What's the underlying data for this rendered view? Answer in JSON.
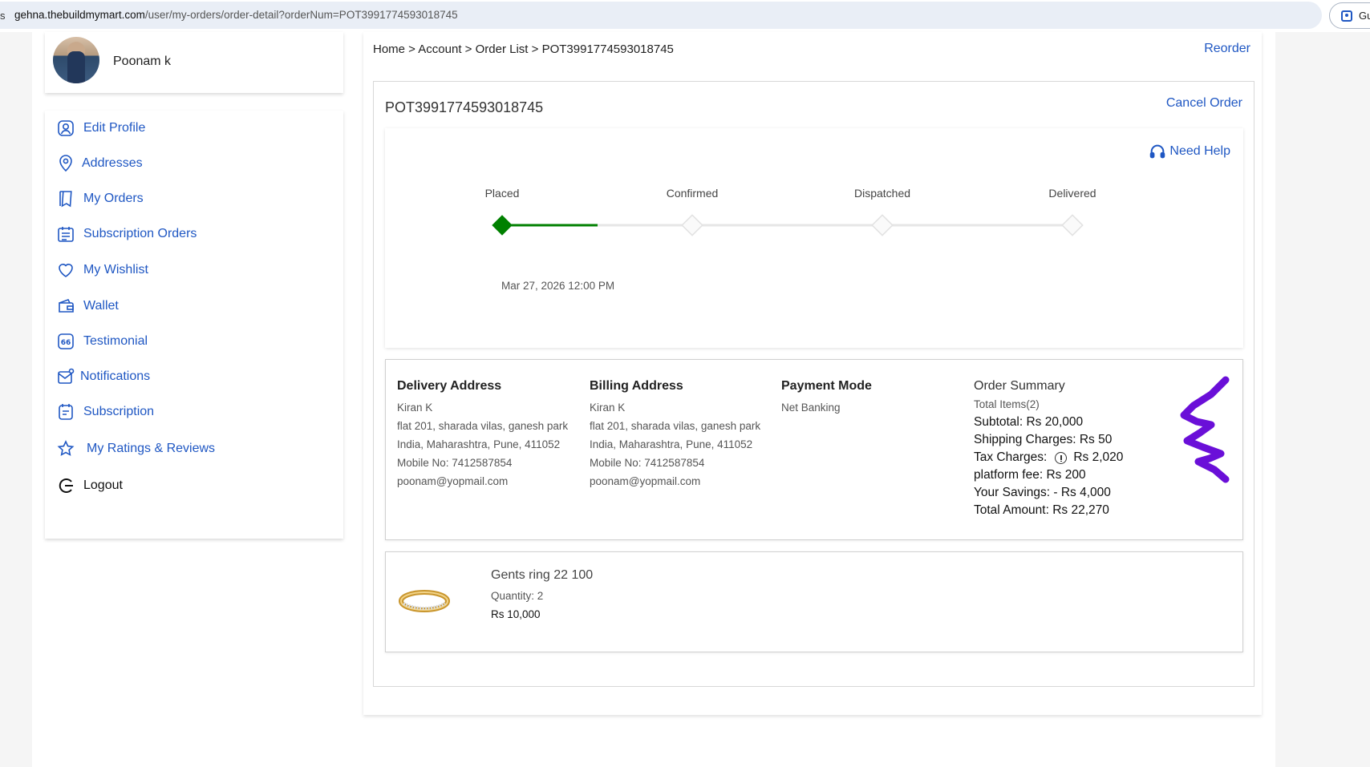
{
  "browser": {
    "url_prefix": "gehna.thebuildmymart.com",
    "url_path": "/user/my-orders/order-detail?orderNum=POT3991774593018745",
    "left_glyph": "s",
    "profile_chip_label": "Gu"
  },
  "profile": {
    "name": "Poonam k"
  },
  "menu": [
    {
      "label": "Edit Profile",
      "icon": "user-icon"
    },
    {
      "label": "Addresses",
      "icon": "location-pin-icon"
    },
    {
      "label": "My Orders",
      "icon": "bookmark-icon"
    },
    {
      "label": "Subscription Orders",
      "icon": "calendar-list-icon"
    },
    {
      "label": "My Wishlist",
      "icon": "heart-icon"
    },
    {
      "label": "Wallet",
      "icon": "wallet-icon"
    },
    {
      "label": "Testimonial",
      "icon": "quote-icon"
    },
    {
      "label": "Notifications",
      "icon": "mail-notification-icon"
    },
    {
      "label": "Subscription",
      "icon": "subscription-icon"
    },
    {
      "label": "My Ratings & Reviews",
      "icon": "star-icon"
    },
    {
      "label": "Logout",
      "icon": "logout-icon"
    }
  ],
  "breadcrumb": [
    "Home",
    "Account",
    "Order List",
    "POT3991774593018745"
  ],
  "breadcrumb_sep": " > ",
  "reorder_label": "Reorder",
  "order": {
    "id": "POT3991774593018745",
    "cancel_label": "Cancel Order",
    "need_help_label": "Need Help",
    "steps": [
      {
        "label": "Placed",
        "done": true
      },
      {
        "label": "Confirmed",
        "done": false
      },
      {
        "label": "Dispatched",
        "done": false
      },
      {
        "label": "Delivered",
        "done": false
      }
    ],
    "placed_date": "Mar 27, 2026 12:00 PM",
    "progress_color": "#008000"
  },
  "delivery": {
    "title": "Delivery Address",
    "lines": [
      "Kiran K",
      "flat 201, sharada vilas, ganesh park",
      "India, Maharashtra, Pune, 411052",
      "Mobile No: 7412587854",
      "poonam@yopmail.com"
    ]
  },
  "billing": {
    "title": "Billing Address",
    "lines": [
      "Kiran K",
      "flat 201, sharada vilas, ganesh park",
      "India, Maharashtra, Pune, 411052",
      "Mobile No: 7412587854",
      "poonam@yopmail.com"
    ]
  },
  "payment": {
    "title": "Payment Mode",
    "value": "Net Banking"
  },
  "summary": {
    "title": "Order Summary",
    "total_items": "Total Items(2)",
    "subtotal": "Subtotal: Rs 20,000",
    "shipping": "Shipping Charges: Rs 50",
    "tax_label": "Tax Charges:",
    "tax_value": "Rs 2,020",
    "platform_fee": "platform fee: Rs 200",
    "savings": "Your Savings: - Rs 4,000",
    "total": "Total Amount: Rs 22,270"
  },
  "product": {
    "name": "Gents ring 22 100",
    "quantity": "Quantity: 2",
    "price": "Rs 10,000"
  },
  "colors": {
    "link": "#1f57c3",
    "accent_green": "#008000",
    "annotation": "#6a0fd8"
  }
}
